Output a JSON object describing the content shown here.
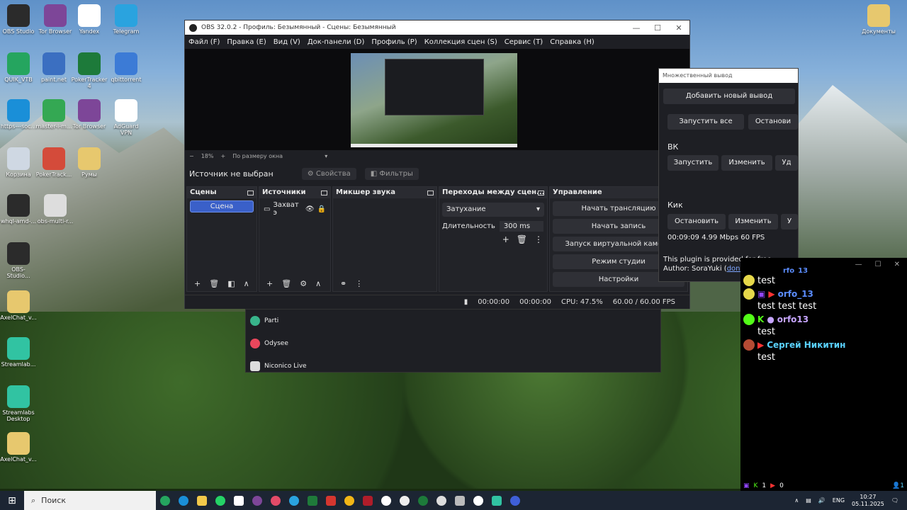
{
  "desktop": {
    "icons": [
      {
        "label": "OBS Studio",
        "icon": "obs-icon",
        "color": "#2b2b2b"
      },
      {
        "label": "Tor Browser",
        "icon": "tor-icon",
        "color": "#7d4698"
      },
      {
        "label": "Yandex",
        "icon": "yandex-icon",
        "color": "#ffffff"
      },
      {
        "label": "Telegram",
        "icon": "telegram-icon",
        "color": "#2aa3df"
      },
      {
        "label": "QUIK_VTB",
        "icon": "quik-icon",
        "color": "#25a55f"
      },
      {
        "label": "paint.net",
        "icon": "paint-icon",
        "color": "#3b6fc1"
      },
      {
        "label": "PokerTracker 4",
        "icon": "pokertracker-icon",
        "color": "#1d7a3a"
      },
      {
        "label": "qbittorrent",
        "icon": "qbittorrent-icon",
        "color": "#3c7bd6"
      },
      {
        "label": "https---soc...",
        "icon": "edge-icon",
        "color": "#1a8fd8"
      },
      {
        "label": "master-i-m...",
        "icon": "chrome-icon",
        "color": "#34a853"
      },
      {
        "label": "Tor Browser",
        "icon": "tor-icon",
        "color": "#7d4698"
      },
      {
        "label": "AdGuard VPN",
        "icon": "adguard-icon",
        "color": "#ffffff"
      },
      {
        "label": "Корзина",
        "icon": "recycle-bin-icon",
        "color": "#cfd8e3"
      },
      {
        "label": "PokerTrack...",
        "icon": "chrome-icon",
        "color": "#d44b3a"
      },
      {
        "label": "Румы",
        "icon": "folder-icon",
        "color": "#e7c86e"
      },
      {
        "label": "whql-amd-...",
        "icon": "amd-icon",
        "color": "#2b2b2b"
      },
      {
        "label": "obs-multi-r...",
        "icon": "installer-icon",
        "color": "#dddddd"
      },
      {
        "label": "OBS-Studio...",
        "icon": "obs-icon",
        "color": "#2b2b2b"
      },
      {
        "label": "AxelChat_v...",
        "icon": "folder-icon",
        "color": "#e7c86e"
      },
      {
        "label": "Streamlab...",
        "icon": "streamlabs-icon",
        "color": "#31c3a2"
      },
      {
        "label": "Streamlabs Desktop",
        "icon": "streamlabs-icon",
        "color": "#31c3a2"
      },
      {
        "label": "AxelChat_v...",
        "icon": "folder-icon",
        "color": "#e7c86e"
      },
      {
        "label": "Документы",
        "icon": "folder-icon",
        "color": "#e7c86e"
      }
    ]
  },
  "obs": {
    "title": "OBS 32.0.2 - Профиль: Безымянный - Сцены: Безымянный",
    "menu": [
      "Файл (F)",
      "Правка (E)",
      "Вид (V)",
      "Док-панели (D)",
      "Профиль (P)",
      "Коллекция сцен (S)",
      "Сервис (T)",
      "Справка (H)"
    ],
    "zoom": {
      "minus": "−",
      "value": "18%",
      "plus": "+",
      "fit": "По размеру окна"
    },
    "source_bar": {
      "none": "Источник не выбран",
      "props": "Свойства",
      "filters": "Фильтры"
    },
    "docks": {
      "scenes": {
        "title": "Сцены",
        "item": "Сцена"
      },
      "sources": {
        "title": "Источники",
        "item": "Захват э"
      },
      "mixer": {
        "title": "Микшер звука"
      },
      "transitions": {
        "title": "Переходы между сцен...",
        "select": "Затухание",
        "duration_label": "Длительность",
        "duration_value": "300 ms"
      },
      "controls": {
        "title": "Управление",
        "buttons": [
          "Начать трансляцию",
          "Начать запись",
          "Запуск виртуальной камеры",
          "Режим студии",
          "Настройки"
        ]
      }
    },
    "status": {
      "stream_time": "00:00:00",
      "rec_time": "00:00:00",
      "cpu": "CPU: 47.5%",
      "fps": "60.00 / 60.00 FPS"
    }
  },
  "dropdown": {
    "items": [
      {
        "label": "Parti",
        "color": "#38b48b"
      },
      {
        "label": "Odysee",
        "color": "#e9475c"
      },
      {
        "label": "Niconico Live",
        "color": "#dddddd"
      }
    ]
  },
  "multi_output": {
    "title": "Множественный вывод",
    "add": "Добавить новый вывод",
    "start_all": "Запустить все",
    "stop_all": "Останови",
    "vk": {
      "name": "ВК",
      "start": "Запустить",
      "edit": "Изменить",
      "delete": "Уд"
    },
    "kick": {
      "name": "Кик",
      "stop": "Остановить",
      "edit": "Изменить",
      "delete": "У"
    },
    "stats": "00:09:09  4.99 Mbps  60 FPS",
    "footer1": "This plugin is provided for free.",
    "footer2_prefix": "Author: SoraYuki (",
    "footer2_link": "donate",
    "footer2_suffix": ")"
  },
  "chat": {
    "first_user_partial": "rfo_13",
    "messages": [
      {
        "text": "test"
      },
      {
        "user": "orfo_13",
        "text": "test test test",
        "user_color": "#5b8dff"
      },
      {
        "user": "orfo13",
        "text": "test",
        "user_color": "#c7a6ff"
      },
      {
        "user": "Сергей Никитин",
        "text": "test",
        "user_color": "#5ad2ff"
      }
    ],
    "counts": {
      "twitch": "",
      "kick": "1",
      "youtube": "0"
    },
    "viewers": "1"
  },
  "taskbar": {
    "search": "Поиск",
    "lang": "ENG",
    "time": "10:27",
    "date": "05.11.2025"
  }
}
